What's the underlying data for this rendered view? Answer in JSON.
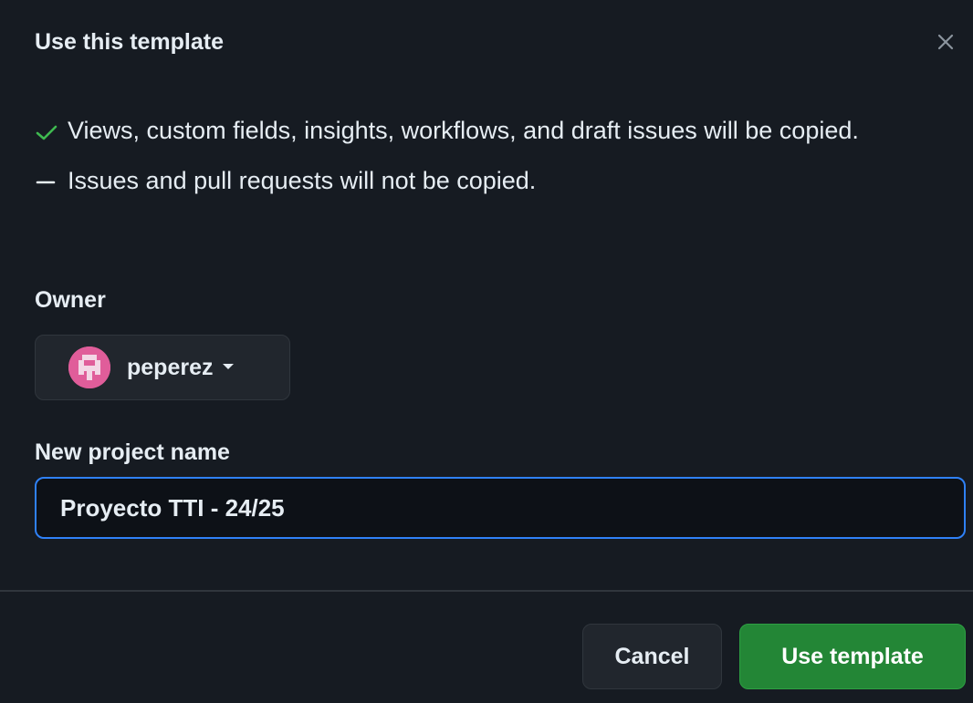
{
  "dialog": {
    "title": "Use this template",
    "close_icon": "close-icon"
  },
  "info": {
    "copied_text": "Views, custom fields, insights, workflows, and draft issues will be copied.",
    "copied_icon": "check-icon",
    "not_copied_text": "Issues and pull requests will not be copied.",
    "not_copied_icon": "dash-icon"
  },
  "owner": {
    "label": "Owner",
    "selected": "peperez",
    "avatar_icon": "avatar",
    "caret_icon": "caret-down-icon"
  },
  "project_name": {
    "label": "New project name",
    "value": "Proyecto TTI - 24/25"
  },
  "footer": {
    "cancel_label": "Cancel",
    "submit_label": "Use template"
  },
  "colors": {
    "background": "#161b22",
    "check": "#3fb950",
    "focus_border": "#2f81f7",
    "primary": "#238636",
    "avatar": "#e05d9a"
  }
}
